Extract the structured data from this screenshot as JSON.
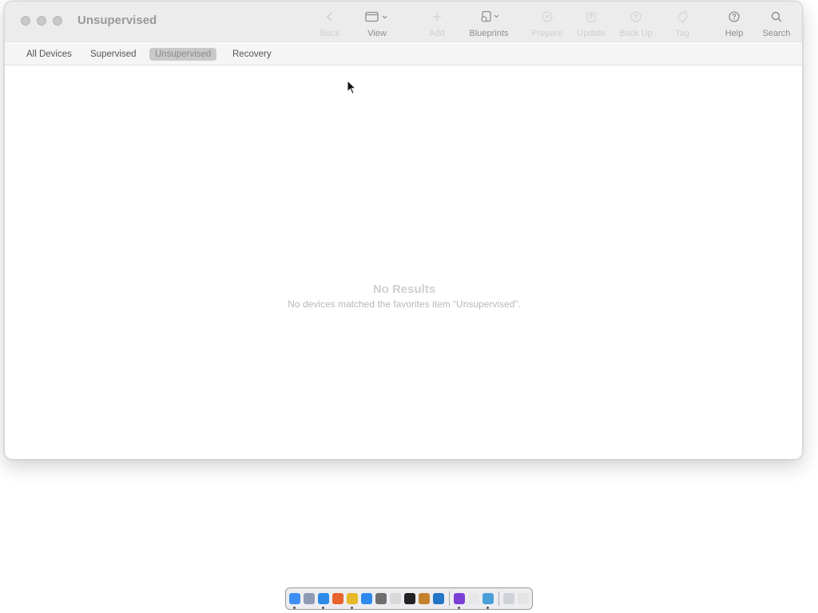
{
  "window": {
    "title": "Unsupervised"
  },
  "toolbar": {
    "back": "Back",
    "view": "View",
    "add": "Add",
    "blueprints": "Blueprints",
    "prepare": "Prepare",
    "update": "Update",
    "backup": "Back Up",
    "tag": "Tag",
    "help": "Help",
    "search": "Search"
  },
  "tabs": [
    {
      "label": "All Devices"
    },
    {
      "label": "Supervised"
    },
    {
      "label": "Unsupervised",
      "active": true
    },
    {
      "label": "Recovery"
    }
  ],
  "empty_state": {
    "title": "No Results",
    "message": "No devices matched the favorites item “Unsupervised”."
  },
  "dock": {
    "apps": [
      {
        "icon": "finder-icon",
        "color": "#3d8ff5",
        "running": true
      },
      {
        "icon": "launchpad-icon",
        "color": "#8f9bb5",
        "running": false
      },
      {
        "icon": "safari-icon",
        "color": "#2b8be6",
        "running": true
      },
      {
        "icon": "firefox-icon",
        "color": "#e8632b",
        "running": false
      },
      {
        "icon": "chrome-icon",
        "color": "#e6b92b",
        "running": true
      },
      {
        "icon": "app-store-icon",
        "color": "#2f8af0",
        "running": false
      },
      {
        "icon": "system-settings-icon",
        "color": "#6f6f6f",
        "running": false
      },
      {
        "icon": "script-editor-icon",
        "color": "#d9d9d9",
        "running": false
      },
      {
        "icon": "terminal-icon",
        "color": "#222222",
        "running": false
      },
      {
        "icon": "instruments-icon",
        "color": "#c4812e",
        "running": false
      },
      {
        "icon": "vscode-icon",
        "color": "#2476c7",
        "running": false
      },
      {
        "icon": "apple-configurator-icon",
        "color": "#7c3fd6",
        "running": true
      },
      {
        "icon": "notes-list-icon",
        "color": "#e8e8e8",
        "running": false
      },
      {
        "icon": "xcode-instruments-icon",
        "color": "#4a9fd8",
        "running": true
      },
      {
        "icon": "screenshot-icon",
        "color": "#cfd3d8",
        "running": false
      },
      {
        "icon": "trash-icon",
        "color": "#e4e4e4",
        "running": false
      }
    ],
    "separator_after": [
      10,
      13
    ]
  }
}
